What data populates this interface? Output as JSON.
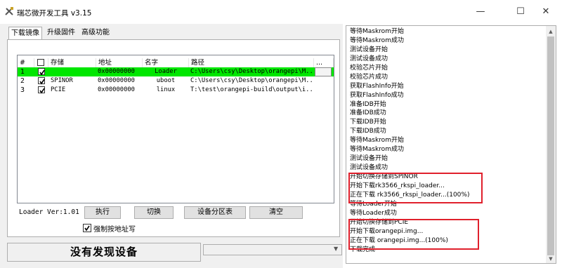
{
  "window": {
    "title": "瑞芯微开发工具 v3.15",
    "min_symbol": "—",
    "max_symbol": "☐",
    "close_symbol": "✕"
  },
  "tabs": [
    {
      "label": "下载镜像",
      "active": true
    },
    {
      "label": "升级固件",
      "active": false
    },
    {
      "label": "高级功能",
      "active": false
    }
  ],
  "grid": {
    "columns": [
      "#",
      "",
      "存储",
      "地址",
      "名字",
      "路径",
      "..."
    ],
    "rows": [
      {
        "index": "1",
        "checked": true,
        "storage": "",
        "address": "0x00000000",
        "name": "Loader",
        "path": "C:\\Users\\csy\\Desktop\\orangepi\\M...",
        "selected": true
      },
      {
        "index": "2",
        "checked": true,
        "storage": "SPINOR",
        "address": "0x00000000",
        "name": "uboot",
        "path": "C:\\Users\\csy\\Desktop\\orangepi\\M...",
        "selected": false
      },
      {
        "index": "3",
        "checked": true,
        "storage": "PCIE",
        "address": "0x00000000",
        "name": "linux",
        "path": "T:\\test\\orangepi-build\\output\\i...",
        "selected": false
      }
    ]
  },
  "controls": {
    "loader_version": "Loader Ver:1.01",
    "execute_label": "执行",
    "switch_label": "切换",
    "partition_label": "设备分区表",
    "clear_label": "清空",
    "force_addr_label": "强制按地址写",
    "force_addr_checked": true
  },
  "status": {
    "text": "没有发现设备",
    "combo_value": ""
  },
  "log": {
    "lines": [
      "等待Maskrom开始",
      "等待Maskrom成功",
      "测试设备开始",
      "测试设备成功",
      "校验芯片开始",
      "校验芯片成功",
      "获取FlashInfo开始",
      "获取FlashInfo成功",
      "准备IDB开始",
      "准备IDB成功",
      "下载IDB开始",
      "下载IDB成功",
      "等待Maskrom开始",
      "等待Maskrom成功",
      "测试设备开始",
      "测试设备成功",
      "开始切换存储到SPINOR",
      "开始下载rk3566_rkspi_loader...",
      "正在下载 rk3566_rkspi_loader...(100%)",
      "等待Loader开始",
      "等待Loader成功",
      "开始切换存储到PCIE",
      "开始下载orangepi.img...",
      "正在下载 orangepi.img...(100%)",
      "下载完成"
    ],
    "highlight_color": "#e0202c",
    "selected_row_color": "#00e600"
  }
}
